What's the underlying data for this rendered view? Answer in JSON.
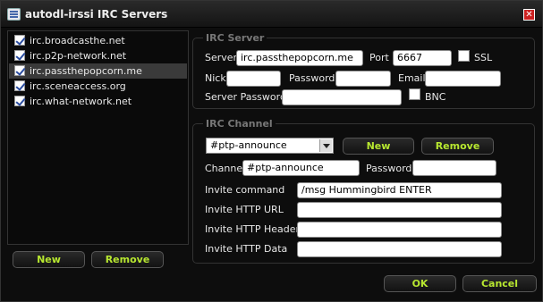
{
  "window": {
    "title": "autodl-irssi IRC Servers",
    "close_glyph": "✕"
  },
  "server_list": {
    "items": [
      {
        "label": "irc.broadcasthe.net",
        "checked": true
      },
      {
        "label": "irc.p2p-network.net",
        "checked": true
      },
      {
        "label": "irc.passthepopcorn.me",
        "checked": true,
        "selected": true
      },
      {
        "label": "irc.sceneaccess.org",
        "checked": true
      },
      {
        "label": "irc.what-network.net",
        "checked": true
      }
    ],
    "new_label": "New",
    "remove_label": "Remove"
  },
  "irc_server": {
    "group_title": "IRC Server",
    "server_label": "Server",
    "server_value": "irc.passthepopcorn.me",
    "port_label": "Port",
    "port_value": "6667",
    "ssl_label": "SSL",
    "nick_label": "Nick",
    "nick_value": "",
    "password_label": "Password",
    "password_value": "",
    "email_label": "Email",
    "email_value": "",
    "server_password_label": "Server Password",
    "server_password_value": "",
    "bnc_label": "BNC"
  },
  "irc_channel": {
    "group_title": "IRC Channel",
    "selected_channel": "#ptp-announce",
    "new_label": "New",
    "remove_label": "Remove",
    "channel_label": "Channel",
    "channel_value": "#ptp-announce",
    "password_label": "Password",
    "password_value": "",
    "invite_command_label": "Invite command",
    "invite_command_value": "/msg Hummingbird ENTER",
    "invite_http_url_label": "Invite HTTP URL",
    "invite_http_url_value": "",
    "invite_http_header_label": "Invite HTTP Header",
    "invite_http_header_value": "",
    "invite_http_data_label": "Invite HTTP Data",
    "invite_http_data_value": ""
  },
  "footer": {
    "ok_label": "OK",
    "cancel_label": "Cancel"
  }
}
